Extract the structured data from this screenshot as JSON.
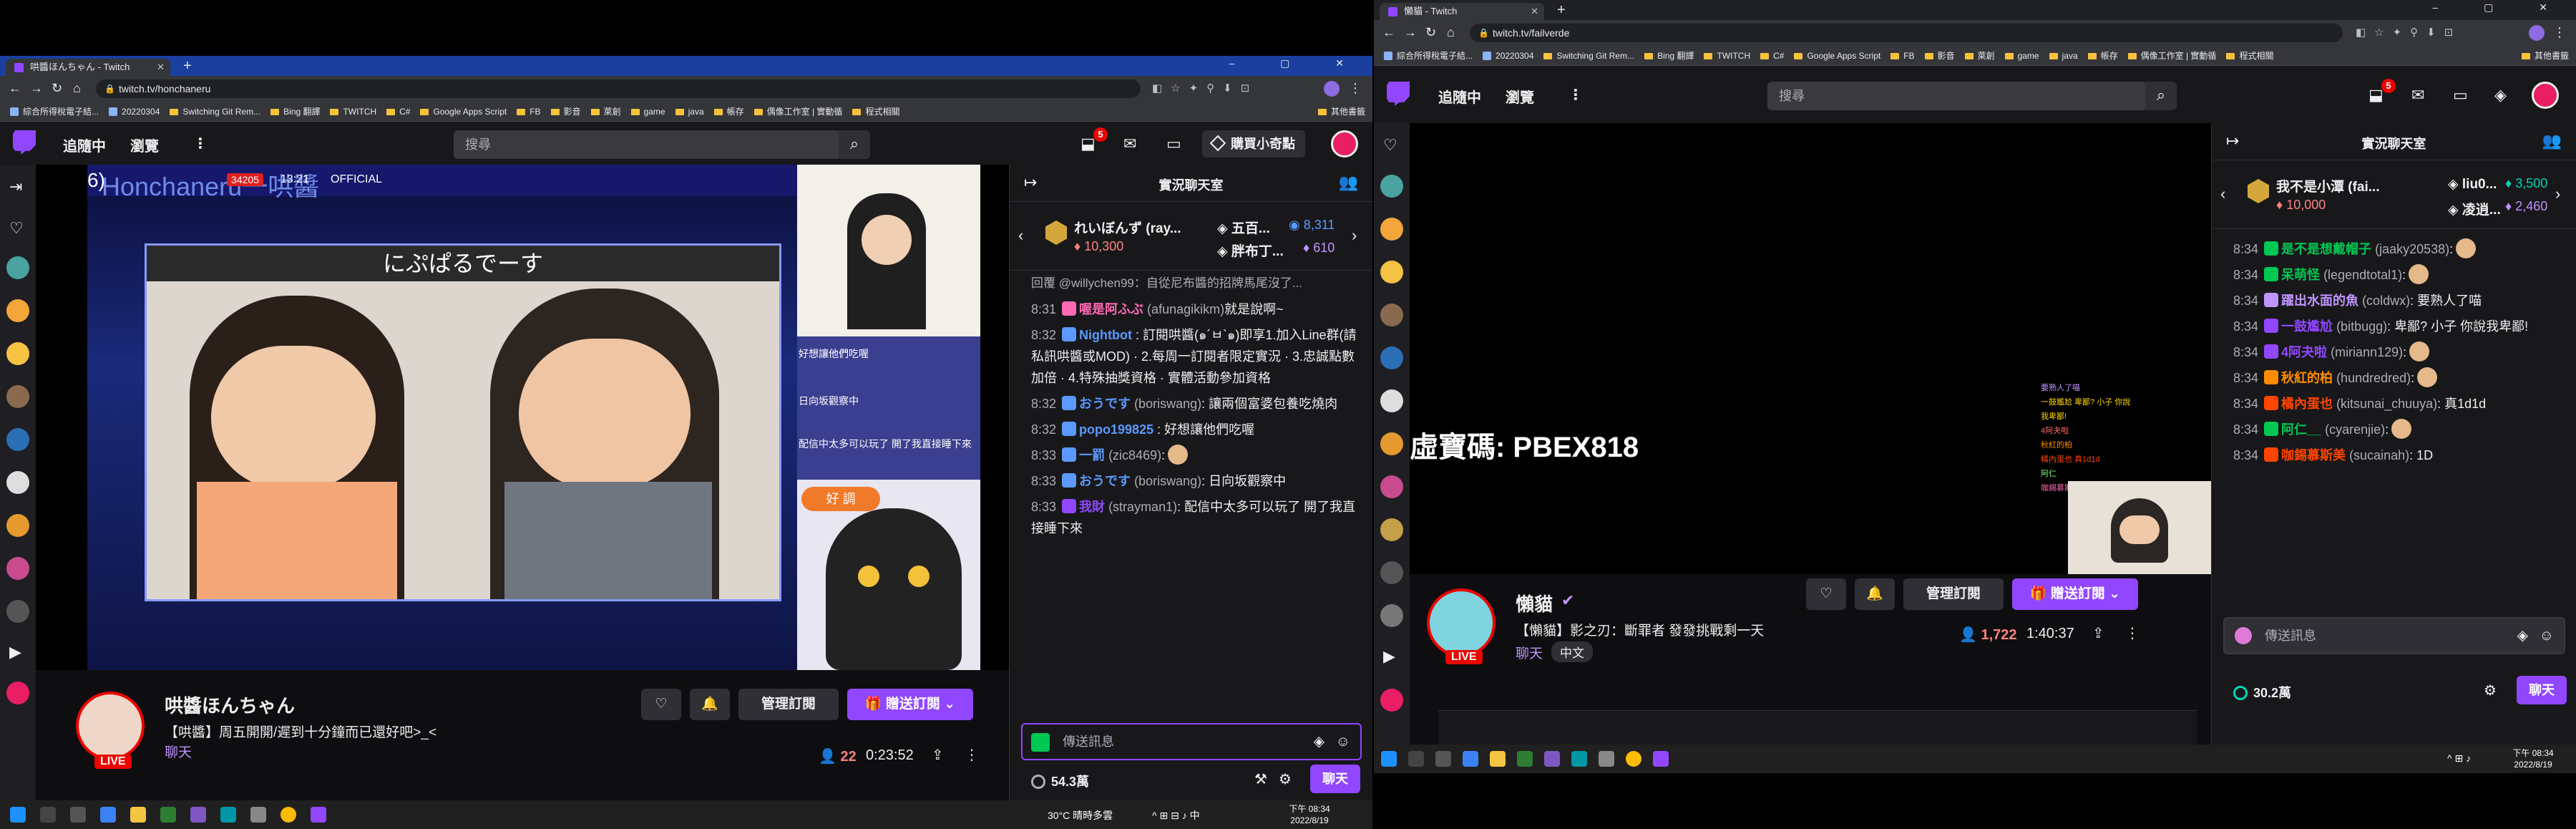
{
  "left": {
    "tab_title": "哄醬ほんちゃん - Twitch",
    "url": "twitch.tv/honchaneru",
    "bookmarks": [
      "綜合所得稅電子結...",
      "20220304",
      "Switching Git Rem...",
      "Bing 翻譯",
      "TWITCH",
      "C#",
      "Google Apps Script",
      "FB",
      "影音",
      "萊創",
      "game",
      "java",
      "帳存",
      "偶像工作室 | 實動循",
      "程式相關"
    ],
    "bookmarks_other": "其他書籤",
    "nav": {
      "following": "追隨中",
      "browse": "瀏覽",
      "search_placeholder": "搜尋",
      "notif_count": "5",
      "bits_label": "購買小奇點"
    },
    "video": {
      "overlay_title": "Honchaneru一哄醬",
      "overlay_official": "OFFICIAL",
      "overlay_num": "6)",
      "live_badge": "34205",
      "overlay_time": "13:21",
      "caption": "にぷぱるでーす",
      "side_chat": [
        "好想讓他們吃喔",
        "日向坂觀察中",
        "配信中太多可以玩了 開了我直接睡下來"
      ],
      "side_btn": "好 調"
    },
    "stream": {
      "name": "哄醬ほんちゃん",
      "title": "【哄醬】周五開開/遲到十分鐘而已還好吧>_<",
      "category": "聊天",
      "live": "LIVE",
      "viewers": "22",
      "uptime": "0:23:52",
      "manage_sub": "管理訂閱",
      "gift_sub": "贈送訂閱"
    },
    "chat": {
      "header": "實況聊天室",
      "leader": {
        "rank1": "れいぼんず (ray...",
        "rank1_bits": "10,300",
        "rank2": "五百...",
        "rank2_pts": "8,311",
        "rank3": "胖布丁...",
        "rank3_pts": "610"
      },
      "reply_line": "回覆 @willychen99：自從尼布醬的招牌馬尾沒了...",
      "messages": [
        {
          "t": "8:31",
          "u": "喔是阿ふぶ",
          "l": "(afunagikikm)",
          "m": "就是說啊~",
          "c": "#ff69b4"
        },
        {
          "t": "8:32",
          "u": "Nightbot",
          "l": "",
          "m": ": 訂閱哄醬(๑´ㅂ`๑)即享1.加入Line群(請私訊哄醬或MOD) · 2.每周一訂閱者限定實況 · 3.忠誠點數加倍 · 4.特殊抽獎資格 · 實體活動參加資格",
          "c": "#5b99ff"
        },
        {
          "t": "8:32",
          "u": "おうです",
          "l": "(boriswang)",
          "m": ": 讓兩個富婆包養吃燒肉",
          "c": "#5b99ff"
        },
        {
          "t": "8:32",
          "u": "popo199825",
          "l": "",
          "m": ": 好想讓他們吃喔",
          "c": "#5b99ff"
        },
        {
          "t": "8:33",
          "u": "一罰",
          "l": "(zic8469)",
          "m": ":",
          "c": "#5b99ff"
        },
        {
          "t": "8:33",
          "u": "おうです",
          "l": "(boriswang)",
          "m": ": 日向坂觀察中",
          "c": "#5b99ff"
        },
        {
          "t": "8:33",
          "u": "我財",
          "l": "(strayman1)",
          "m": ": 配信中太多可以玩了 開了我直接睡下來",
          "c": "#9147ff"
        }
      ],
      "input_placeholder": "傳送訊息",
      "points": "54.3萬",
      "chat_btn": "聊天"
    },
    "taskbar": {
      "weather": "30°C 晴時多雲",
      "time": "下午 08:34",
      "date": "2022/8/19"
    }
  },
  "right": {
    "tab_title": "懶貓 - Twitch",
    "url": "twitch.tv/failverde",
    "bookmarks": [
      "綜合所得稅電子結...",
      "20220304",
      "Switching Git Rem...",
      "Bing 翻譯",
      "TWITCH",
      "C#",
      "Google Apps Script",
      "FB",
      "影音",
      "萊創",
      "game",
      "java",
      "帳存",
      "偶像工作室 | 實動循",
      "程式相關"
    ],
    "bookmarks_other": "其他書籤",
    "nav": {
      "following": "追隨中",
      "browse": "瀏覽",
      "search_placeholder": "搜尋",
      "notif_count": "5"
    },
    "video": {
      "overlay_code": "虛寶碼: PBEX818",
      "side_chat": [
        "要熟人了喵",
        "一鼓尷尬 卑鄙? 小子 你說我卑鄙!",
        "4阿夬啦",
        "秋紅的柏",
        "橘內蛋也 真1d1d",
        "阿仁",
        "咖錫慕斯美 1D"
      ]
    },
    "stream": {
      "name": "懶貓",
      "title": "【懶貓】影之刃：斷罪者 發發挑戰剩一天",
      "category": "聊天",
      "lang": "中文",
      "live": "LIVE",
      "viewers": "1,722",
      "uptime": "1:40:37",
      "manage_sub": "管理訂閱",
      "gift_sub": "贈送訂閱"
    },
    "chat": {
      "header": "實況聊天室",
      "leader": {
        "rank1": "我不是小潭 (fai...",
        "rank1_bits": "10,000",
        "rank2": "liu0...",
        "rank2_pts": "3,500",
        "rank3": "凌逍...",
        "rank3_pts": "2,460"
      },
      "messages": [
        {
          "t": "8:34",
          "u": "是不是想戴帽子",
          "l": "(jaaky20538)",
          "m": ":",
          "c": "#00c853"
        },
        {
          "t": "8:34",
          "u": "呆萌怪",
          "l": "(legendtotal1)",
          "m": ":",
          "c": "#00c853"
        },
        {
          "t": "8:34",
          "u": "躍出水面的魚",
          "l": "(coldwx)",
          "m": ": 要熟人了喵",
          "c": "#bf94ff"
        },
        {
          "t": "8:34",
          "u": "一鼓尷尬",
          "l": "(bitbugg)",
          "m": ": 卑鄙? 小子 你說我卑鄙!",
          "c": "#9147ff"
        },
        {
          "t": "8:34",
          "u": "4阿夬啦",
          "l": "(miriann129)",
          "m": ":",
          "c": "#9147ff"
        },
        {
          "t": "8:34",
          "u": "秋紅的柏",
          "l": "(hundredred)",
          "m": ":",
          "c": "#ff8c00"
        },
        {
          "t": "8:34",
          "u": "橘內蛋也",
          "l": "(kitsunai_chuuya)",
          "m": ": 真1d1d",
          "c": "#ff4500"
        },
        {
          "t": "8:34",
          "u": "阿仁__",
          "l": "(cyarenjie)",
          "m": ":",
          "c": "#00c853"
        },
        {
          "t": "8:34",
          "u": "咖錫慕斯美",
          "l": "(sucainah)",
          "m": ": 1D",
          "c": "#ff4500"
        }
      ],
      "input_placeholder": "傳送訊息",
      "points": "30.2萬",
      "chat_btn": "聊天"
    },
    "taskbar": {
      "time": "下午 08:34",
      "date": "2022/8/19"
    }
  }
}
